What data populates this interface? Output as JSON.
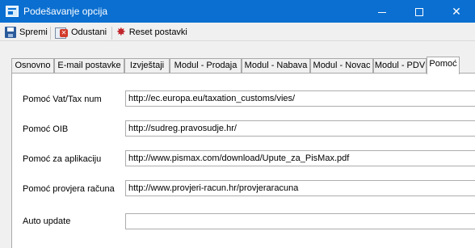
{
  "window": {
    "title": "Podešavanje opcija",
    "controls": {
      "minimize": "–",
      "maximize": "□",
      "close": "✕"
    }
  },
  "toolbar": {
    "save_label": "Spremi",
    "cancel_label": "Odustani",
    "reset_label": "Reset postavki",
    "reset_icon_glyph": "✸"
  },
  "tabs": [
    {
      "label": "Osnovno"
    },
    {
      "label": "E-mail postavke"
    },
    {
      "label": "Izvještaji"
    },
    {
      "label": "Modul - Prodaja"
    },
    {
      "label": "Modul - Nabava"
    },
    {
      "label": "Modul - Novac"
    },
    {
      "label": "Modul - PDV"
    },
    {
      "label": "Pomoć",
      "active": true
    }
  ],
  "help_tab": {
    "rows": [
      {
        "label": "Pomoć Vat/Tax num",
        "value": "http://ec.europa.eu/taxation_customs/vies/"
      },
      {
        "label": "Pomoć OIB",
        "value": "http://sudreg.pravosudje.hr/"
      },
      {
        "label": "Pomoć za aplikaciju",
        "value": "http://www.pismax.com/download/Upute_za_PisMax.pdf"
      },
      {
        "label": "Pomoć provjera računa",
        "value": "http://www.provjeri-racun.hr/provjeraracuna"
      },
      {
        "label": "Auto update",
        "value": ""
      }
    ]
  },
  "colors": {
    "titlebar": "#0a6fd1",
    "window_bg": "#f0f0f0",
    "tab_border": "#a9a9a9",
    "reset_icon": "#c0262d"
  }
}
